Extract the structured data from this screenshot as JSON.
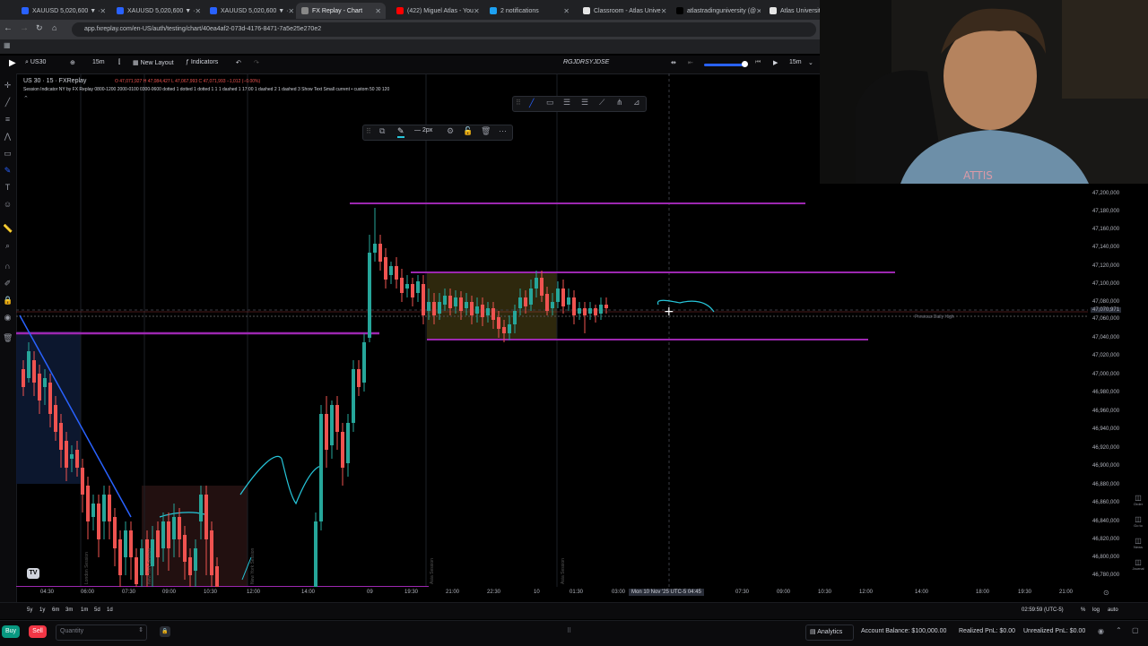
{
  "browser": {
    "tabs": [
      {
        "title": "XAUUSD 5,020,600 ▼ ·",
        "fav": "#2962ff",
        "active": false
      },
      {
        "title": "XAUUSD 5,020,600 ▼ ·",
        "fav": "#2962ff",
        "active": false
      },
      {
        "title": "XAUUSD 5,020,600 ▼ ·",
        "fav": "#2962ff",
        "active": false
      },
      {
        "title": "FX Replay - Chart",
        "fav": "#888888",
        "active": true
      },
      {
        "title": "(422) Miguel Atlas - You",
        "fav": "#ff0000",
        "active": false
      },
      {
        "title": "2 notifications",
        "fav": "#1da1f2",
        "active": false
      },
      {
        "title": "Classroom - Atlas Unive",
        "fav": "#e5e5e5",
        "active": false
      },
      {
        "title": "atlastradinguniversity (@",
        "fav": "#000000",
        "active": false
      },
      {
        "title": "Atlas University",
        "fav": "#e5e5e5",
        "active": false
      }
    ],
    "url": "app.fxreplay.com/en-US/auth/testing/chart/40ea4af2-073d-4176-8471-7a5e25e270e2"
  },
  "toolbar": {
    "symbol": "US30",
    "interval": "15m",
    "new_layout": "New Layout",
    "indicators": "Indicators",
    "center_id": "RGJDRSYJDSE",
    "replay_interval": "15m"
  },
  "legend": {
    "title": "US 30 · 15 · FXReplay",
    "ohlc": "O 47,071,927  H 47,084,427  L 47,067,993  C 47,071,993  −1,012 (−0.00%)",
    "indicator": "Session Indicator NY by FX Replay  0800-1200 2000-0100 0300-0600 dotted 1 dotted 1 dotted 1 1 1 dashed 1 17:00 1 dashed 2 1 dashed 3 Show Text Small current • custom 50 30 120"
  },
  "drawing_toolbar": {
    "width_label": "2px"
  },
  "price_axis": {
    "labels": [
      "47,200,000",
      "47,180,000",
      "47,160,000",
      "47,140,000",
      "47,120,000",
      "47,100,000",
      "47,080,000",
      "47,070,971",
      "47,060,000",
      "47,040,000",
      "47,020,000",
      "47,000,000",
      "46,980,000",
      "46,960,000",
      "46,940,000",
      "46,920,000",
      "46,900,000",
      "46,880,000",
      "46,860,000",
      "46,840,000",
      "46,820,000",
      "46,800,000",
      "46,780,000"
    ],
    "current_price": "47,070,971"
  },
  "time_axis": {
    "labels": [
      "04:30",
      "06:00",
      "07:30",
      "09:00",
      "10:30",
      "12:00",
      "14:00",
      "09",
      "19:30",
      "21:00",
      "22:30",
      "10",
      "01:30",
      "03:00",
      "07:30",
      "09:00",
      "10:30",
      "12:00",
      "14:00",
      "18:00",
      "19:30",
      "21:00"
    ],
    "crosshair_label": "Mon 10 Nov '25 UTC-5   04:45"
  },
  "chart_labels": {
    "previous_daily_high": "Previous Daily High",
    "sessions": [
      "London Session",
      "New York Session",
      "New York Session",
      "Asia Session",
      "Asia Session"
    ]
  },
  "bottom_bar": {
    "ranges": [
      "5y",
      "1y",
      "6m",
      "3m",
      "1m",
      "5d",
      "1d"
    ],
    "clock": "02:59:59 (UTC-5)",
    "pct": "%",
    "log": "log",
    "auto": "auto"
  },
  "trade_bar": {
    "buy": "Buy",
    "sell": "Sell",
    "quantity_placeholder": "Quantity",
    "analytics": "Analytics",
    "account_balance": "Account Balance: $100,000.00",
    "realized_pnl": "Realized PnL: $0.00",
    "unrealized_pnl": "Unrealized PnL: $0.00"
  },
  "right_toolbar": [
    "Order",
    "Go to",
    "News",
    "Journal"
  ],
  "colors": {
    "bull": "#26a69a",
    "bear": "#ef5350",
    "level_line": "#9c27b0",
    "trend_line": "#2962ff",
    "range_box": "#6b5a1e",
    "buy": "#089981",
    "sell": "#f23645",
    "accent": "#2962ff"
  }
}
